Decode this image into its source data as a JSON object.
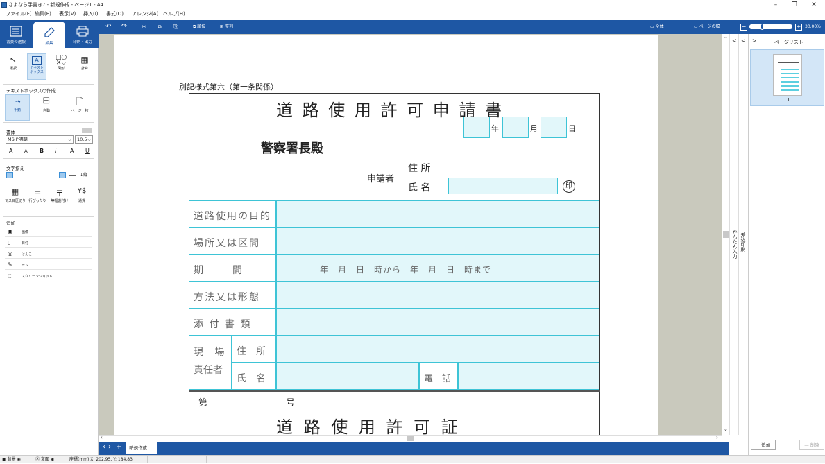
{
  "window": {
    "title": "さよなら手書き7 - 新規作成 - ページ1 - A4",
    "minimize": "–",
    "restore": "❐",
    "close": "✕"
  },
  "menu": [
    "ファイル(F)",
    "編集(E)",
    "表示(V)",
    "挿入(I)",
    "書式(O)",
    "アレンジ(A)",
    "ヘルプ(H)"
  ],
  "left_tabs": [
    "背景の選択",
    "編集",
    "印刷・出力"
  ],
  "tools": [
    "選択",
    "テキスト\nボックス",
    "図形",
    "計算"
  ],
  "textbox_section": {
    "title": "テキストボックスの作成",
    "items": [
      "手動",
      "自動",
      "ページ一枚"
    ]
  },
  "font_section": {
    "title": "書体",
    "font": "MS P明朝",
    "size": "10.5",
    "btn_a_up": "A",
    "btn_a_down": "A",
    "bold": "B",
    "italic": "I",
    "color": "A",
    "underline": "U"
  },
  "align_section": {
    "title": "文字揃え"
  },
  "format_tools": [
    "マス目区切り",
    "行ぴったり",
    "等幅割付け",
    "通貨"
  ],
  "add_section": {
    "title": "追加",
    "items": [
      "画像",
      "日付",
      "はんこ",
      "ペン",
      "スクリーンショット"
    ]
  },
  "toolbar": {
    "undo": "↶",
    "redo": "↷",
    "cut": "✂",
    "copy": "⧉",
    "paste": "⎘",
    "order": "順位",
    "arrange": "整列",
    "fit_all": "全体",
    "fit_width": "ページの幅",
    "zoom_minus": "−",
    "zoom_plus": "+",
    "zoom": "30.00%"
  },
  "form": {
    "note": "別記様式第六（第十条関係）",
    "title": "道 路 使 用 許 可 申 請 書",
    "year": "年",
    "month": "月",
    "day": "日",
    "addressee": "警察署長殿",
    "applicant": "申請者",
    "address": "住 所",
    "name": "氏 名",
    "seal": "印",
    "rows": [
      "道路使用の目的",
      "場所又は区間",
      "期　　　間",
      "方法又は形態",
      "添 付 書 類"
    ],
    "period_text": "年　月　日　時から　年　月　日　時まで",
    "site_label1": "現 場",
    "site_label2": "責任者",
    "site_addr": "住　所",
    "site_name": "氏　名",
    "phone": "電　話",
    "permit_no_label": "第",
    "permit_no_suffix": "号",
    "permit_title": "道 路 使 用 許 可 証"
  },
  "side_strip": {
    "easy": "かんたん入力",
    "merge": "差込印刷"
  },
  "pagelist": {
    "title": "ページリスト",
    "page_num": "1",
    "add": "+ 追加",
    "delete": "— 削除",
    "nav_left": "<",
    "nav_left2": "<",
    "nav_right": ">"
  },
  "bottom": {
    "tab": "新規作成",
    "add": "+",
    "prev": "‹",
    "next": "›"
  },
  "status": {
    "bg": "背景",
    "text": "文面",
    "coords": "座標(mm) X: 202.95, Y: 184.83"
  }
}
